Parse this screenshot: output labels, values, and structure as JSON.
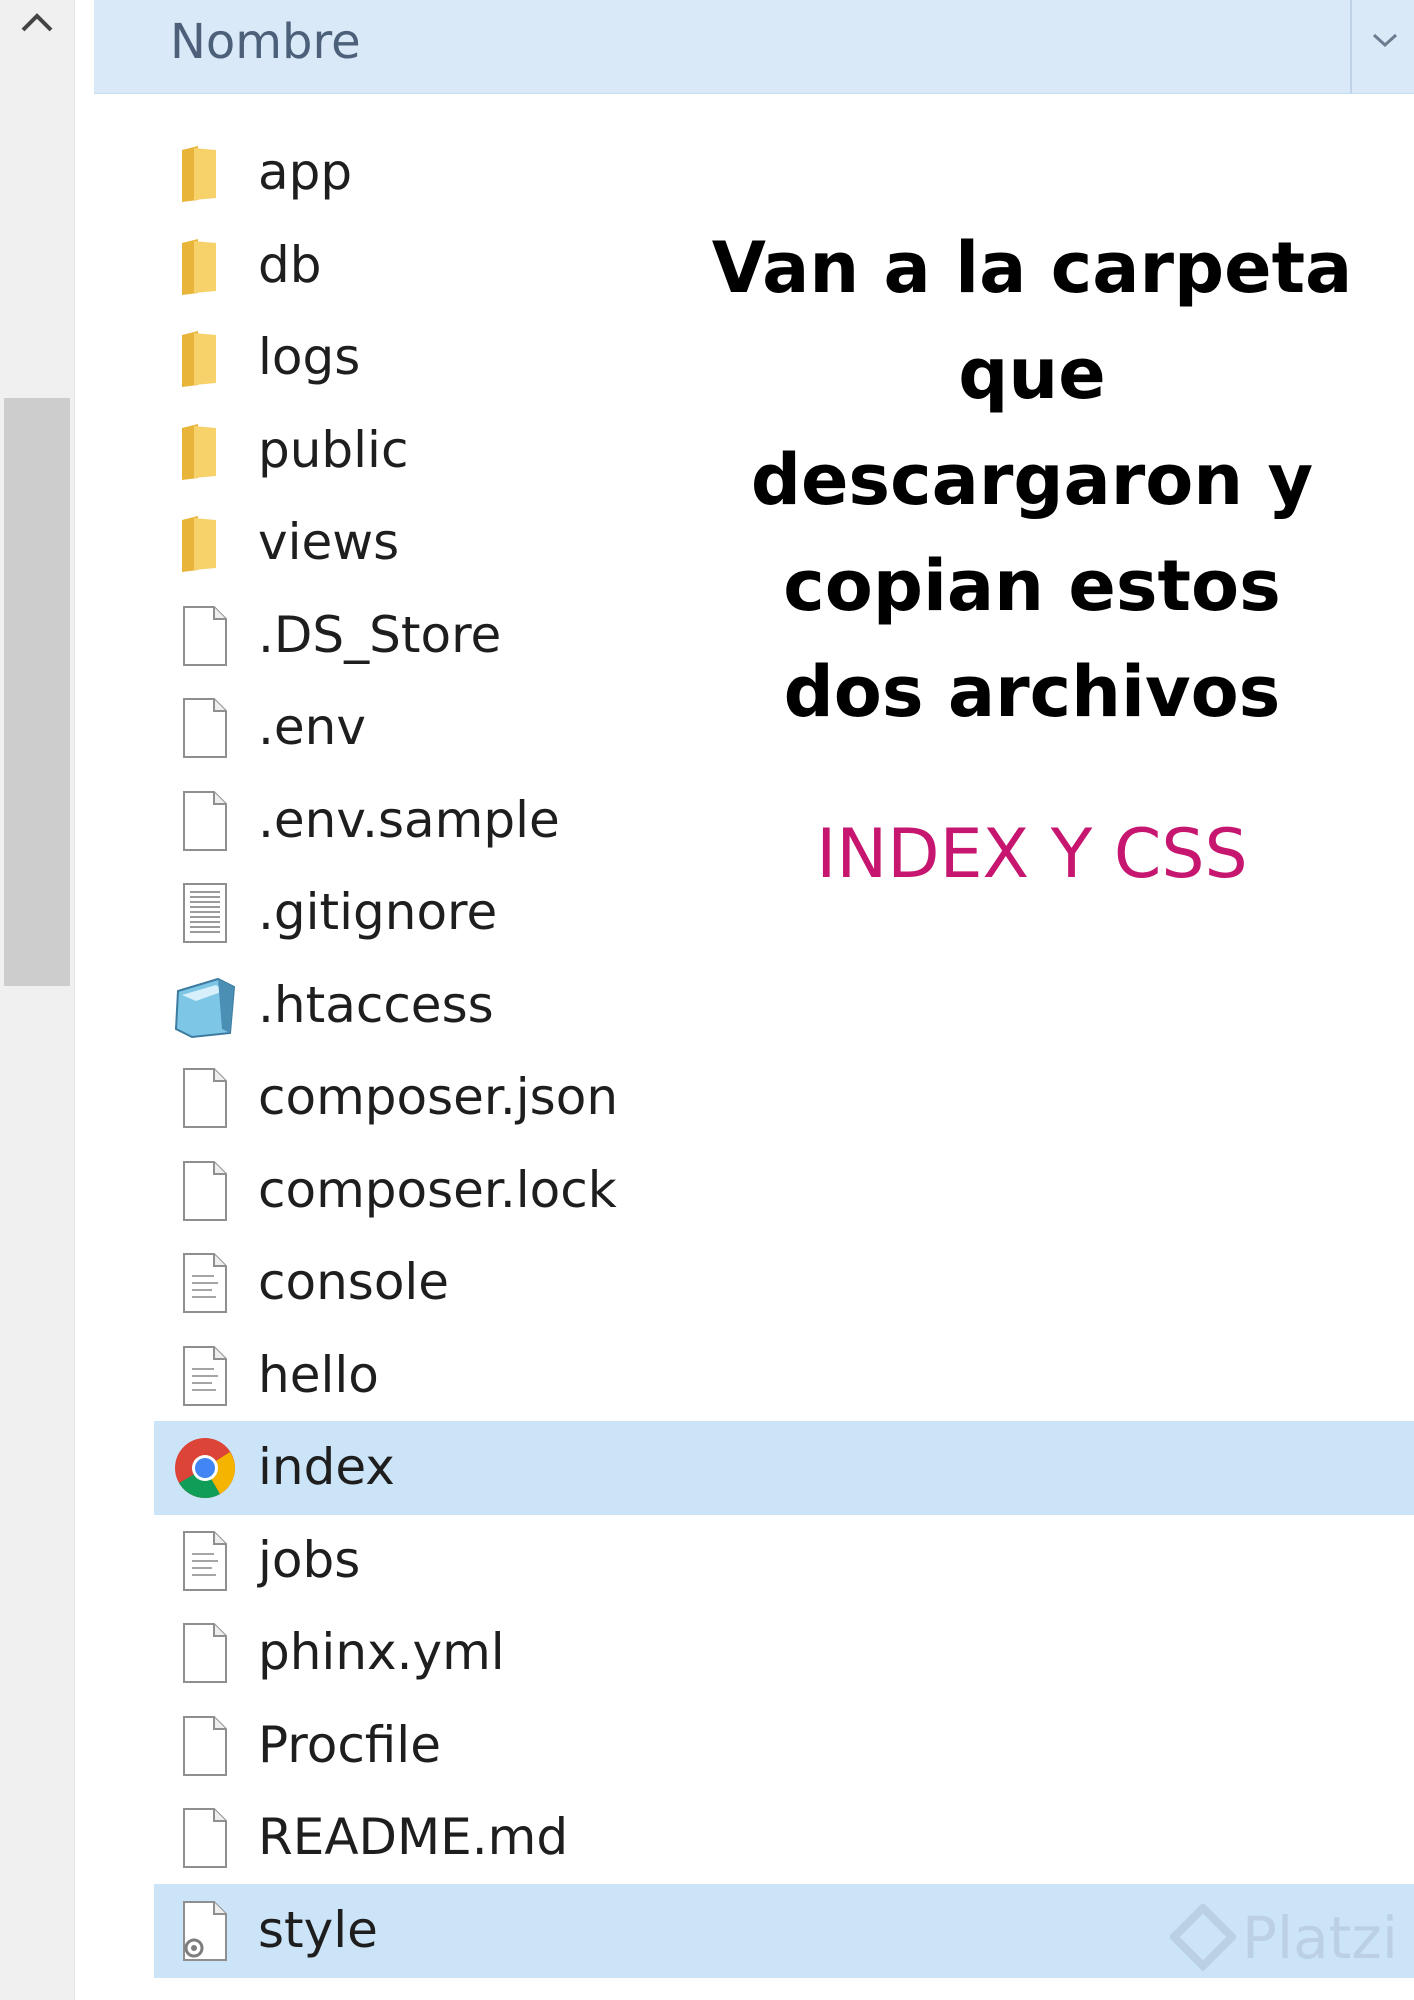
{
  "header": {
    "column_name": "Nombre"
  },
  "files": [
    {
      "label": "app",
      "icon": "folder-icon",
      "selected": false
    },
    {
      "label": "db",
      "icon": "folder-icon",
      "selected": false
    },
    {
      "label": "logs",
      "icon": "folder-icon",
      "selected": false
    },
    {
      "label": "public",
      "icon": "folder-icon",
      "selected": false
    },
    {
      "label": "views",
      "icon": "folder-icon",
      "selected": false
    },
    {
      "label": ".DS_Store",
      "icon": "blank-file-icon",
      "selected": false
    },
    {
      "label": ".env",
      "icon": "blank-file-icon",
      "selected": false
    },
    {
      "label": ".env.sample",
      "icon": "blank-file-icon",
      "selected": false
    },
    {
      "label": ".gitignore",
      "icon": "text-file-icon",
      "selected": false
    },
    {
      "label": ".htaccess",
      "icon": "notepad-file-icon",
      "selected": false
    },
    {
      "label": "composer.json",
      "icon": "blank-file-icon",
      "selected": false
    },
    {
      "label": "composer.lock",
      "icon": "blank-file-icon",
      "selected": false
    },
    {
      "label": "console",
      "icon": "text-lines-file-icon",
      "selected": false
    },
    {
      "label": "hello",
      "icon": "text-lines-file-icon",
      "selected": false
    },
    {
      "label": "index",
      "icon": "chrome-icon",
      "selected": true
    },
    {
      "label": "jobs",
      "icon": "text-lines-file-icon",
      "selected": false
    },
    {
      "label": "phinx.yml",
      "icon": "blank-file-icon",
      "selected": false
    },
    {
      "label": "Procfile",
      "icon": "blank-file-icon",
      "selected": false
    },
    {
      "label": "README.md",
      "icon": "blank-file-icon",
      "selected": false
    },
    {
      "label": "style",
      "icon": "css-file-icon",
      "selected": true
    }
  ],
  "overlay": {
    "lines": [
      "Van a la carpeta",
      "que",
      "descargaron y",
      "copian estos",
      "dos archivos"
    ],
    "highlight": "INDEX Y CSS",
    "highlight_color": "#c6166f"
  },
  "watermark": {
    "text": "Platzi"
  },
  "colors": {
    "header_bg": "#d9e9f8",
    "selected_bg": "#cce4f7",
    "folder": "#f5c94a"
  }
}
